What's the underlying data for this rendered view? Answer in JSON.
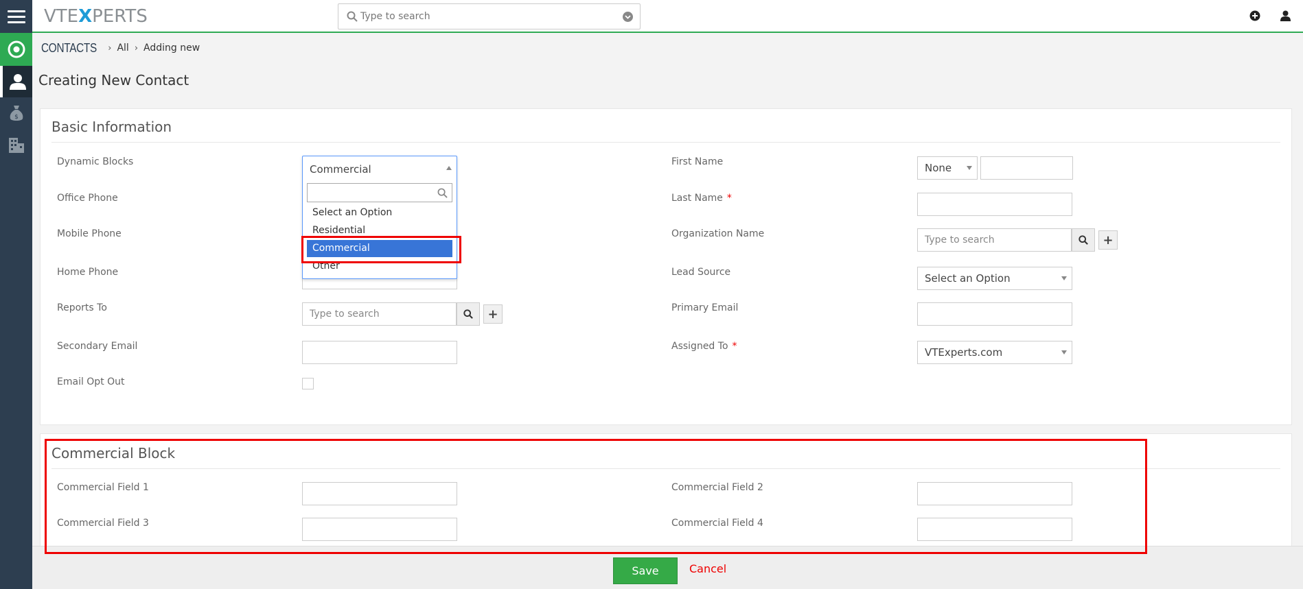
{
  "topbar": {
    "logo_prefix": "VTE",
    "logo_x": "X",
    "logo_suffix": "PERTS",
    "search_placeholder": "Type to search"
  },
  "breadcrumb": {
    "module": "CONTACTS",
    "level1": "All",
    "level2": "Adding new"
  },
  "page_title": "Creating New Contact",
  "basic": {
    "title": "Basic Information",
    "labels": {
      "dynamic_blocks": "Dynamic Blocks",
      "office_phone": "Office Phone",
      "mobile_phone": "Mobile Phone",
      "home_phone": "Home Phone",
      "reports_to": "Reports To",
      "secondary_email": "Secondary Email",
      "email_opt_out": "Email Opt Out",
      "first_name": "First Name",
      "last_name": "Last Name",
      "organization_name": "Organization Name",
      "lead_source": "Lead Source",
      "primary_email": "Primary Email",
      "assigned_to": "Assigned To"
    },
    "required_mark": "*",
    "dynamic_blocks_value": "Commercial",
    "dynamic_blocks_options": [
      "Select an Option",
      "Residential",
      "Commercial",
      "Other"
    ],
    "salutation_value": "None",
    "reports_to_placeholder": "Type to search",
    "organization_placeholder": "Type to search",
    "lead_source_value": "Select an Option",
    "assigned_to_value": "VTExperts.com",
    "plus": "+"
  },
  "commercial": {
    "title": "Commercial Block",
    "field1": "Commercial Field 1",
    "field2": "Commercial Field 2",
    "field3": "Commercial Field 3",
    "field4": "Commercial Field 4"
  },
  "footer": {
    "save": "Save",
    "cancel": "Cancel"
  },
  "colors": {
    "sidebar": "#2d3e50",
    "accent_green": "#2eaa53",
    "highlight_blue": "#3875d7",
    "annotation_red": "#ee0000"
  }
}
